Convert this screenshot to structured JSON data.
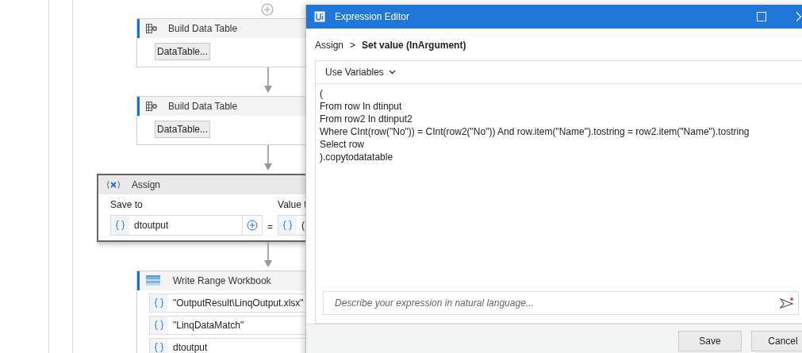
{
  "workflow": {
    "steps": [
      {
        "kind": "build_table",
        "title": "Build Data Table",
        "button": "DataTable..."
      },
      {
        "kind": "build_table",
        "title": "Build Data Table",
        "button": "DataTable..."
      },
      {
        "kind": "assign",
        "title": "Assign",
        "save_label": "Save to",
        "save_value": "dtoutput",
        "operator": "=",
        "value_label": "Value t",
        "value_value": "("
      },
      {
        "kind": "write_range",
        "title": "Write Range Workbook",
        "args": [
          "\"OutputResult\\LinqOutput.xlsx\"",
          "\"LinqDataMatch\"",
          "dtoutput"
        ]
      }
    ]
  },
  "dialog": {
    "title": "Expression Editor",
    "breadcrumb": {
      "parent": "Assign",
      "separator": ">",
      "current": "Set value (InArgument)"
    },
    "toolbar_button": "Use Variables",
    "code_lines": [
      "(",
      "From row In dtinput",
      "From row2 In dtinput2",
      "Where CInt(row(\"No\")) = CInt(row2(\"No\")) And row.item(\"Name\").tostring = row2.item(\"Name\").tostring",
      "Select row",
      ").copytodatatable"
    ],
    "prompt": {
      "placeholder": "Describe your expression in natural language..."
    },
    "buttons": [
      "Save",
      "Cancel"
    ]
  }
}
